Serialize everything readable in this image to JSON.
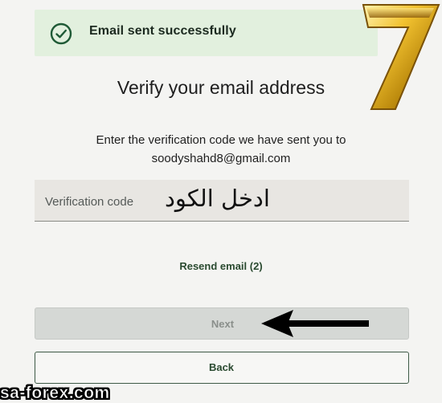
{
  "banner": {
    "message": "Email sent successfully",
    "icon": "check-circle-icon",
    "background_color": "#e2f0de",
    "icon_color": "#1f5a36"
  },
  "heading": {
    "title": "Verify your email address",
    "description_line1": "Enter the verification code we have sent you to",
    "email": "soodyshahd8@gmail.com"
  },
  "form": {
    "verification_placeholder": "Verification code",
    "annotation_arabic": "ادخل الكود"
  },
  "actions": {
    "resend_label": "Resend email (2)",
    "next_label": "Next",
    "back_label": "Back",
    "accent_color": "#2a4a30"
  },
  "overlay": {
    "watermark": "sa-forex.com",
    "logo_icon": "gold-seven-logo",
    "arrow_icon": "left-arrow-icon"
  }
}
